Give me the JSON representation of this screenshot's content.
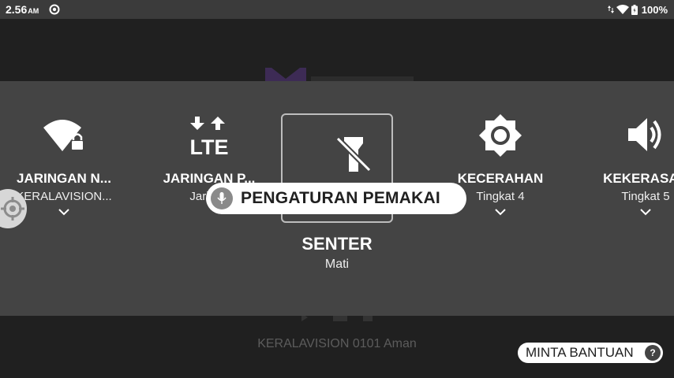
{
  "status_bar": {
    "time": "2.56",
    "ampm": "AM",
    "battery_percent": "100%",
    "icons": [
      "settings-gear-icon",
      "data-arrows-icon",
      "wifi-icon",
      "battery-icon"
    ]
  },
  "background": {
    "status_text": "KERALAVISION 0101 Aman"
  },
  "quick_settings": {
    "tiles": [
      {
        "label": "JARINGAN N...",
        "sub": "KERALAVISION...",
        "icon": "wifi-lock-icon"
      },
      {
        "label": "JARINGAN P...",
        "sub": "Jaringa",
        "icon": "lte-icon"
      },
      {
        "label": "SENTER",
        "sub": "Mati",
        "icon": "flashlight-off-icon"
      },
      {
        "label": "KECERAHAN",
        "sub": "Tingkat 4",
        "icon": "brightness-icon"
      },
      {
        "label": "KEKERASAN",
        "sub": "Tingkat 5",
        "icon": "volume-icon"
      }
    ]
  },
  "voice_access": {
    "command_text": "PENGATURAN PEMAKAI",
    "icon": "microphone-icon"
  },
  "help_button": {
    "label": "MINTA BANTUAN",
    "icon_text": "?"
  },
  "colors": {
    "panel": "#444444",
    "background": "#202020",
    "statusbar": "#3b3b3b"
  }
}
